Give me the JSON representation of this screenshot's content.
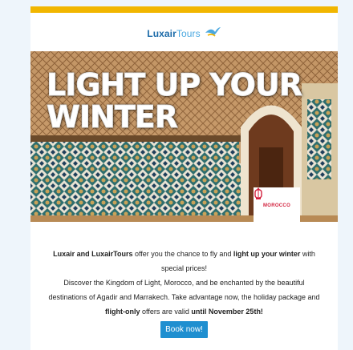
{
  "brand": {
    "name_part1": "Luxair",
    "name_part2": "Tours",
    "logo_icon": "bird-icon"
  },
  "hero": {
    "title_line1": "LIGHT UP YOUR",
    "title_line2": "WINTER",
    "badge_label": "MOROCCO",
    "badge_icon": "moroccan-lantern-icon"
  },
  "body": {
    "line1": {
      "b1": "Luxair and LuxairTours",
      "t1": " offer you the chance to fly and ",
      "b2": "light up your winter",
      "t2": " with"
    },
    "line2": "special prices!",
    "line3": "Discover the Kingdom of Light, Morocco, and be enchanted by the beautiful",
    "line4": "destinations of Agadir and Marrakech. Take advantage now, the holiday package and",
    "line5": {
      "b1": "flight-only",
      "t1": " offers are valid ",
      "b2": "until November 25th!"
    }
  },
  "cta": {
    "label": "Book now!"
  },
  "colors": {
    "accent_bar": "#f1b600",
    "brand_blue": "#1b6aa8",
    "cta_blue": "#1f8fd0",
    "badge_red": "#d21f3c"
  }
}
